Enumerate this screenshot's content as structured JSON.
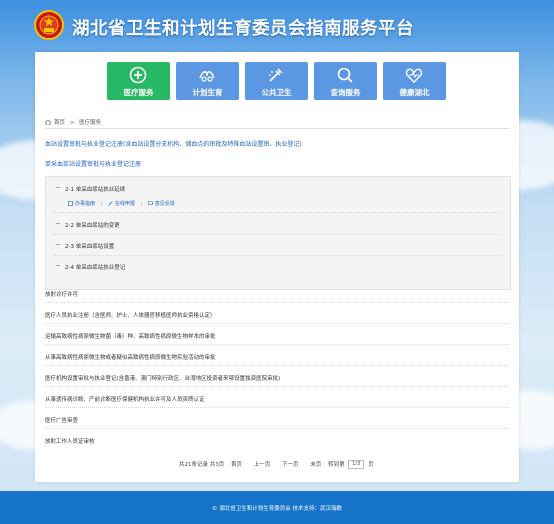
{
  "header": {
    "title": "湖北省卫生和计划生育委员会指南服务平台"
  },
  "nav": {
    "items": [
      {
        "label": "医疗服务",
        "icon": "plus-circle-icon",
        "active": true
      },
      {
        "label": "计划生育",
        "icon": "family-planning-icon",
        "active": false
      },
      {
        "label": "公共卫生",
        "icon": "public-health-icon",
        "active": false
      },
      {
        "label": "查询服务",
        "icon": "search-icon",
        "active": false
      },
      {
        "label": "健康湖北",
        "icon": "heart-pulse-icon",
        "active": false
      }
    ]
  },
  "breadcrumb": {
    "home": "首页",
    "separator": ">",
    "current": "医疗服务"
  },
  "main": {
    "section_heading": "血站设置审批与执业登记注册(含血站设置分支机构、储血点的审批及特殊血站设置审、执业登记)",
    "subsection_heading": "单采血浆站设置审批与执业登记注册",
    "sub_items": [
      {
        "label": "2-1 单采血浆站执业延续"
      },
      {
        "label": "2-2 单采血浆站的变更"
      },
      {
        "label": "2-3 单采血浆站设置"
      },
      {
        "label": "2-4 单采血浆站执业登记"
      }
    ],
    "actions": [
      {
        "label": "办事指南",
        "icon": "document-icon"
      },
      {
        "label": "在线申报",
        "icon": "edit-icon"
      },
      {
        "label": "意见反馈",
        "icon": "feedback-icon"
      }
    ],
    "list": [
      "放射诊疗许可",
      "医疗人员执业注册（含医师、护士、人体器官移植医师执业资格认定）",
      "运输高致病性病原微生物菌（毒）种、高致病性病原微生物样本的审批",
      "从事高致病性病原微生物或者疑似高致病性病原微生物实验活动的审批",
      "医疗机构设置审批与执业登记(含香港、澳门特别行政区、台湾地区投资者来鄂设置独资医院审批)",
      "从事遗传病诊断、产前诊断医疗保健机构执业许可及人员资质认证",
      "医疗广告审查",
      "放射工作人员证审核"
    ]
  },
  "pager": {
    "summary": "共21条记录 共3页",
    "first": "首页",
    "prev": "上一页",
    "next": "下一页",
    "last": "末页",
    "goto_label": "转到第",
    "page_value": "1/3",
    "page_suffix": "页"
  },
  "footer": {
    "text": "© 湖北省卫生和计划生育委员会  技术支持：武汉瑞数"
  },
  "colors": {
    "nav_active": "#27b866",
    "nav_default": "#5c97e3",
    "link_blue": "#1f63c1",
    "footer_bg": "#1574c9"
  }
}
